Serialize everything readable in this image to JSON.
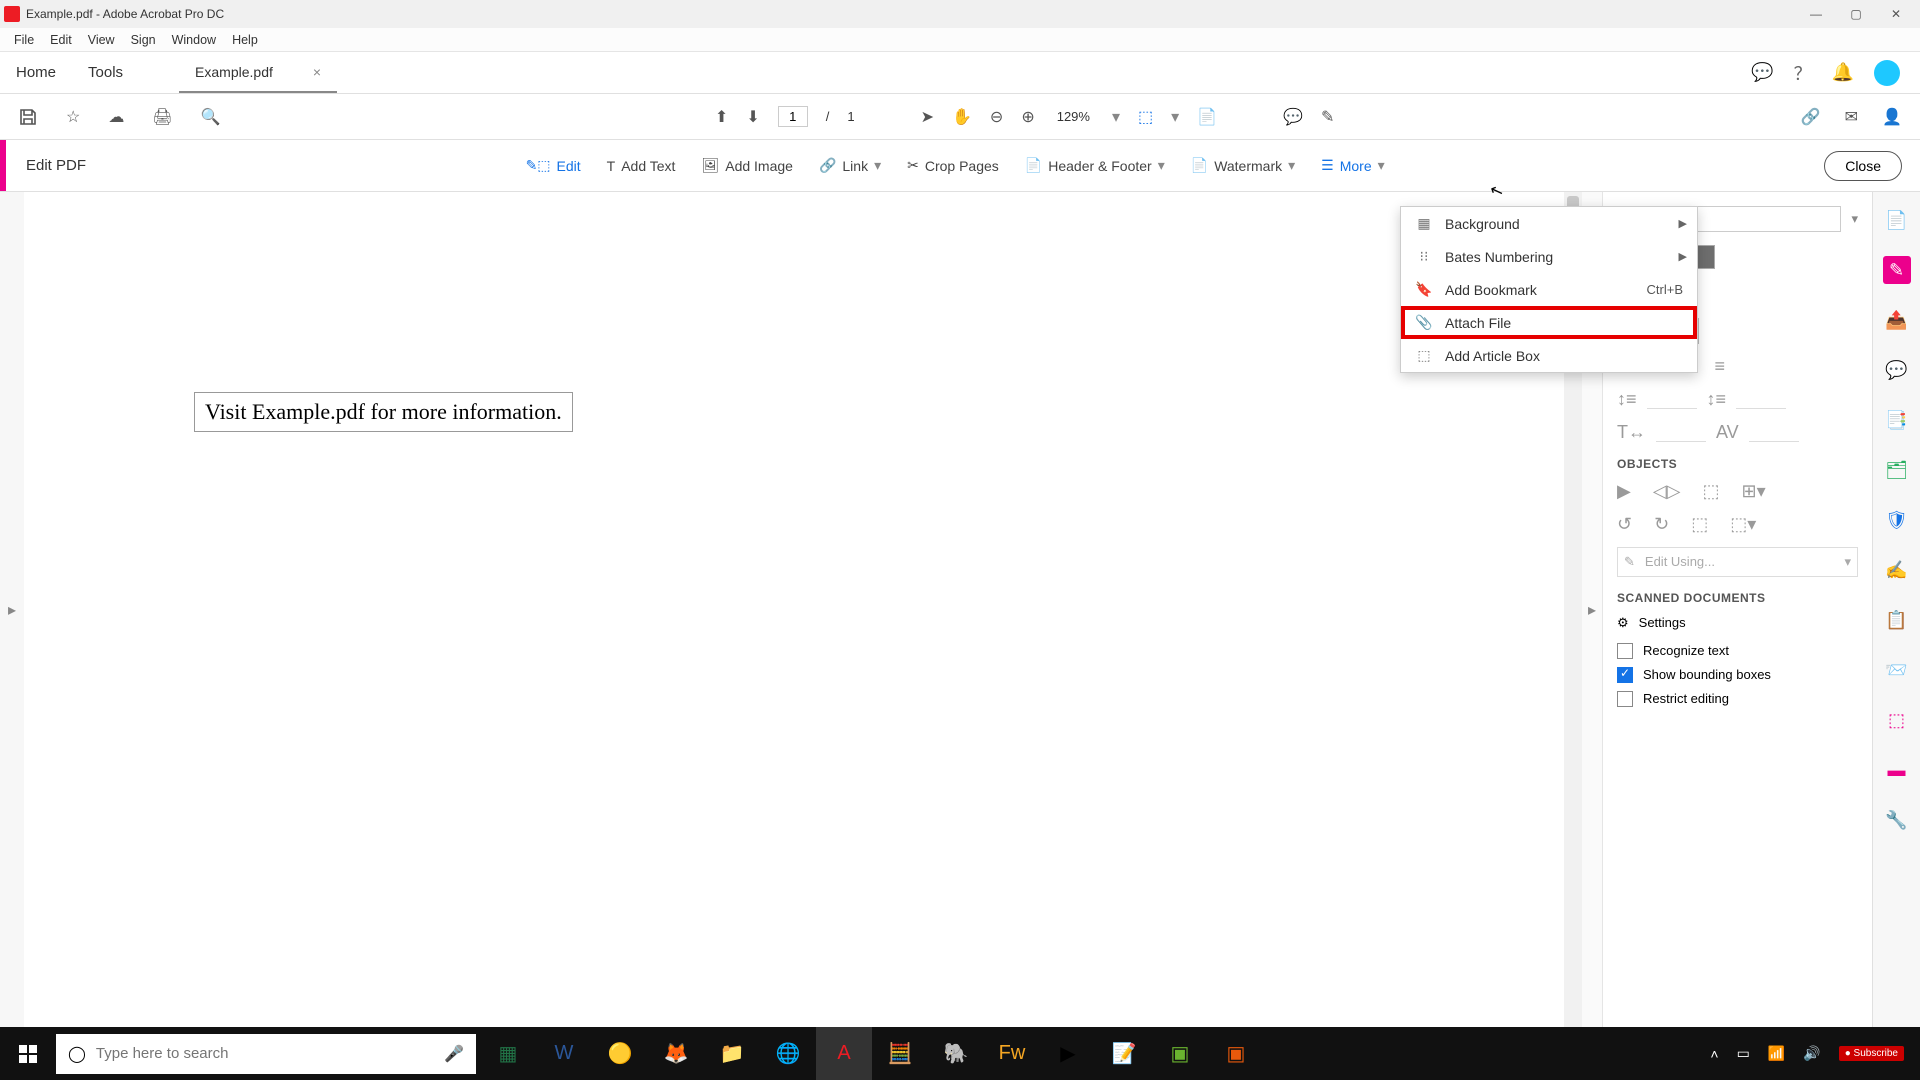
{
  "window": {
    "title": "Example.pdf - Adobe Acrobat Pro DC"
  },
  "menubar": {
    "file": "File",
    "edit": "Edit",
    "view": "View",
    "sign": "Sign",
    "window": "Window",
    "help": "Help"
  },
  "tabs": {
    "home": "Home",
    "tools": "Tools",
    "doc": "Example.pdf"
  },
  "toolbar": {
    "page_current": "1",
    "page_sep": "/",
    "page_total": "1",
    "zoom": "129%"
  },
  "editbar": {
    "title": "Edit PDF",
    "edit": "Edit",
    "add_text": "Add Text",
    "add_image": "Add Image",
    "link": "Link",
    "crop_pages": "Crop Pages",
    "header_footer": "Header & Footer",
    "watermark": "Watermark",
    "more": "More",
    "close": "Close"
  },
  "more_menu": {
    "background": "Background",
    "bates": "Bates Numbering",
    "bookmark": "Add Bookmark",
    "bookmark_shortcut": "Ctrl+B",
    "attach": "Attach File",
    "article_box": "Add Article Box"
  },
  "document_text": "Visit Example.pdf for more information.",
  "panel": {
    "objects": "OBJECTS",
    "edit_using": "Edit Using...",
    "scanned": "SCANNED DOCUMENTS",
    "settings": "Settings",
    "recognize": "Recognize text",
    "show_boxes": "Show bounding boxes",
    "restrict": "Restrict editing"
  },
  "taskbar": {
    "search_placeholder": "Type here to search"
  }
}
